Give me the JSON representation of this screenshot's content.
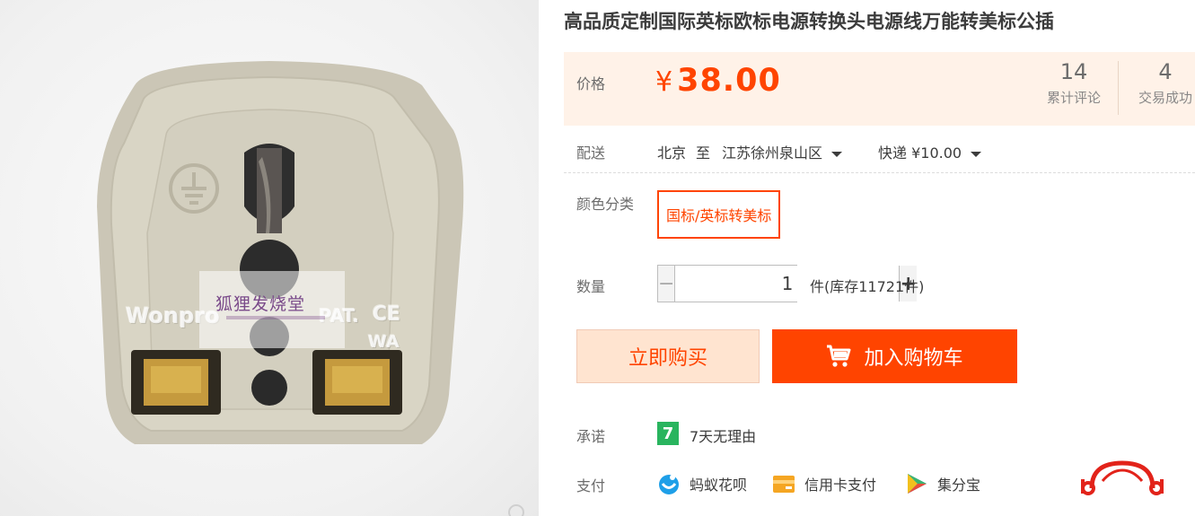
{
  "product": {
    "title": "高品质定制国际英标欧标电源转换头电源线万能转美标公插",
    "image_alt": "product-photo-universal-plug-adapter",
    "watermark_text": "狐狸发烧堂",
    "emboss_brand": "Wonpro",
    "emboss_pat": "PAT.",
    "emboss_ce": "CE",
    "emboss_wa": "WA"
  },
  "price": {
    "label": "价格",
    "currency": "¥",
    "amount": "38.00",
    "reviews_count": "14",
    "reviews_label": "累计评论",
    "deals_count": "4",
    "deals_label": "交易成功"
  },
  "shipping": {
    "label": "配送",
    "from": "北京",
    "to_word": "至",
    "destination": "江苏徐州泉山区",
    "method": "快递 ¥10.00"
  },
  "sku": {
    "label": "颜色分类",
    "selected_option": "国标/英标转美标"
  },
  "quantity": {
    "label": "数量",
    "value": "1",
    "stock_text": "件(库存11721件)"
  },
  "actions": {
    "buy_now": "立即购买",
    "add_to_cart": "加入购物车"
  },
  "promise": {
    "label": "承诺",
    "badge": "7",
    "text": "7天无理由"
  },
  "payment": {
    "label": "支付",
    "methods": [
      "蚂蚁花呗",
      "信用卡支付",
      "集分宝"
    ]
  },
  "colors": {
    "accent": "#ff4400",
    "price_panel_bg": "#fff2e8",
    "buy_now_bg": "#ffe4d0",
    "promise_badge": "#29b45e"
  }
}
